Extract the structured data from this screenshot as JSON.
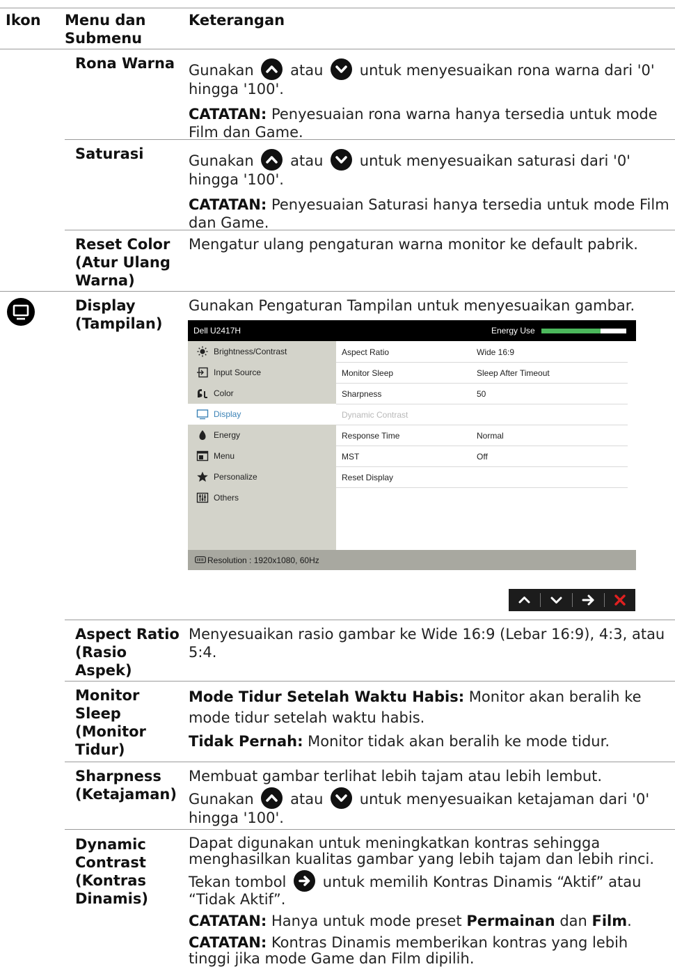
{
  "header": {
    "col1": "Ikon",
    "col2": "Menu dan Submenu",
    "col3": "Keterangan"
  },
  "rows": {
    "rona": {
      "term": "Rona Warna",
      "use1": "Gunakan",
      "use2": "atau",
      "use3": "untuk menyesuaikan rona warna dari '0' hingga '100'.",
      "note_label": "CATATAN:",
      "note_text": " Penyesuaian rona warna hanya tersedia untuk mode Film dan Game."
    },
    "saturasi": {
      "term": "Saturasi",
      "use1": "Gunakan",
      "use2": "atau",
      "use3": "untuk menyesuaikan saturasi dari '0' hingga '100'.",
      "note_label": "CATATAN:",
      "note_text": " Penyesuaian Saturasi hanya tersedia untuk mode Film dan Game."
    },
    "reset_color": {
      "term": "Reset Color (Atur Ulang Warna)",
      "desc": "Mengatur ulang pengaturan warna monitor ke default pabrik."
    },
    "display": {
      "term": "Display (Tampilan)",
      "desc": "Gunakan Pengaturan Tampilan untuk menyesuaikan gambar.",
      "icon": "monitor-icon"
    },
    "aspect": {
      "term": "Aspect Ratio (Rasio Aspek)",
      "desc": "Menyesuaikan rasio gambar ke Wide 16:9 (Lebar 16:9), 4:3, atau 5:4."
    },
    "sleep": {
      "term": "Monitor Sleep (Monitor Tidur)",
      "p1_label": "Mode Tidur Setelah Waktu Habis:",
      "p1_text": " Monitor akan beralih ke mode tidur setelah waktu habis.",
      "p2_label": "Tidak Pernah:",
      "p2_text": " Monitor tidak akan beralih ke mode tidur."
    },
    "sharp": {
      "term": "Sharpness (Ketajaman)",
      "line1": "Membuat gambar terlihat lebih tajam atau lebih lembut.",
      "use1": "Gunakan",
      "use2": "atau",
      "use3": "untuk menyesuaikan ketajaman dari '0' hingga '100'."
    },
    "dynamic": {
      "term": "Dynamic Contrast (Kontras Dinamis)",
      "p1": "Dapat digunakan untuk meningkatkan kontras sehingga menghasilkan kualitas gambar yang lebih tajam dan lebih rinci.",
      "p2a": "Tekan tombol",
      "p2b": "untuk memilih Kontras Dinamis “Aktif” atau “Tidak Aktif”.",
      "n1_label": "CATATAN:",
      "n1_a": " Hanya untuk mode preset ",
      "n1_b": "Permainan",
      "n1_c": " dan ",
      "n1_d": "Film",
      "n1_e": ".",
      "n2_label": "CATATAN:",
      "n2_text": " Kontras Dinamis memberikan kontras yang lebih tinggi jika mode Game dan Film dipilih."
    }
  },
  "osd": {
    "model": "Dell U2417H",
    "energy_label": "Energy Use",
    "energy_level": 0.7,
    "energy_color": "#4cb85c",
    "accent_color": "#3b82b6",
    "menu": [
      {
        "label": "Brightness/Contrast",
        "icon": "brightness-icon"
      },
      {
        "label": "Input Source",
        "icon": "input-source-icon"
      },
      {
        "label": "Color",
        "icon": "color-icon"
      },
      {
        "label": "Display",
        "icon": "display-icon",
        "selected": true
      },
      {
        "label": "Energy",
        "icon": "energy-icon"
      },
      {
        "label": "Menu",
        "icon": "menu-icon"
      },
      {
        "label": "Personalize",
        "icon": "star-icon"
      },
      {
        "label": "Others",
        "icon": "others-icon"
      }
    ],
    "settings": [
      {
        "label": "Aspect Ratio",
        "value": "Wide 16:9"
      },
      {
        "label": "Monitor Sleep",
        "value": "Sleep After Timeout"
      },
      {
        "label": "Sharpness",
        "value": "50"
      },
      {
        "label": "Dynamic Contrast",
        "value": "",
        "disabled": true
      },
      {
        "label": "Response Time",
        "value": "Normal"
      },
      {
        "label": "MST",
        "value": "Off"
      },
      {
        "label": "Reset Display",
        "value": ""
      }
    ],
    "resolution": "Resolution : 1920x1080, 60Hz",
    "nav_buttons": [
      "up-icon",
      "down-icon",
      "right-arrow-icon",
      "close-icon"
    ]
  }
}
